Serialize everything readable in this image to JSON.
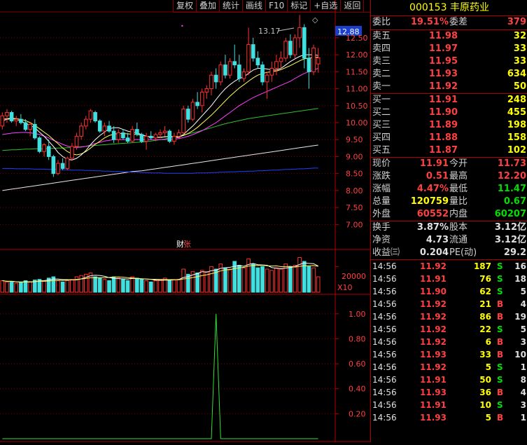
{
  "toolbar": {
    "items": [
      "复权",
      "叠加",
      "统计",
      "画线",
      "F10",
      "标记",
      "+自选",
      "返回"
    ]
  },
  "stock": {
    "code": "000153",
    "name": "丰原药业"
  },
  "ratio": {
    "label": "委比",
    "value": "19.51%",
    "diff_label": "委差",
    "diff": "379"
  },
  "sells": [
    {
      "label": "卖五",
      "price": "11.98",
      "vol": "32"
    },
    {
      "label": "卖四",
      "price": "11.97",
      "vol": "33"
    },
    {
      "label": "卖三",
      "price": "11.95",
      "vol": "33"
    },
    {
      "label": "卖二",
      "price": "11.93",
      "vol": "634"
    },
    {
      "label": "卖一",
      "price": "11.92",
      "vol": "50"
    }
  ],
  "buys": [
    {
      "label": "买一",
      "price": "11.91",
      "vol": "248"
    },
    {
      "label": "买二",
      "price": "11.90",
      "vol": "455"
    },
    {
      "label": "买三",
      "price": "11.89",
      "vol": "198"
    },
    {
      "label": "买四",
      "price": "11.88",
      "vol": "158"
    },
    {
      "label": "买五",
      "price": "11.87",
      "vol": "102"
    }
  ],
  "quote": [
    {
      "l1": "现价",
      "v1": "11.91",
      "l2": "今开",
      "v2": "11.73"
    },
    {
      "l1": "涨跌",
      "v1": "0.51",
      "l2": "最高",
      "v2": "12.20"
    },
    {
      "l1": "涨幅",
      "v1": "4.47%",
      "l2": "最低",
      "v2": "11.47"
    },
    {
      "l1": "总量",
      "v1": "120759",
      "l2": "量比",
      "v2": "0.67"
    },
    {
      "l1": "外盘",
      "v1": "60552",
      "l2": "内盘",
      "v2": "60207"
    }
  ],
  "fund": [
    {
      "l1": "换手",
      "v1": "3.87%",
      "l2": "股本",
      "v2": "3.12亿"
    },
    {
      "l1": "净资",
      "v1": "4.73",
      "l2": "流通",
      "v2": "3.12亿"
    },
    {
      "l1": "收益㈢",
      "v1": "0.204",
      "l2": "PE(动)",
      "v2": "29.2"
    }
  ],
  "ticks": [
    {
      "time": "14:56",
      "price": "11.92",
      "vol": "187",
      "bs": "S",
      "n": "16"
    },
    {
      "time": "14:56",
      "price": "11.91",
      "vol": "76",
      "bs": "S",
      "n": "18"
    },
    {
      "time": "14:56",
      "price": "11.90",
      "vol": "62",
      "bs": "S",
      "n": "5"
    },
    {
      "time": "14:56",
      "price": "11.92",
      "vol": "21",
      "bs": "B",
      "n": "4"
    },
    {
      "time": "14:56",
      "price": "11.92",
      "vol": "86",
      "bs": "B",
      "n": "19"
    },
    {
      "time": "14:56",
      "price": "11.92",
      "vol": "22",
      "bs": "S",
      "n": "5"
    },
    {
      "time": "14:56",
      "price": "11.92",
      "vol": "6",
      "bs": "B",
      "n": "3"
    },
    {
      "time": "14:56",
      "price": "11.93",
      "vol": "33",
      "bs": "B",
      "n": "10"
    },
    {
      "time": "14:56",
      "price": "11.92",
      "vol": "5",
      "bs": "S",
      "n": "1"
    },
    {
      "time": "14:56",
      "price": "11.91",
      "vol": "50",
      "bs": "S",
      "n": "8"
    },
    {
      "time": "14:56",
      "price": "11.93",
      "vol": "36",
      "bs": "B",
      "n": "4"
    },
    {
      "time": "14:56",
      "price": "11.91",
      "vol": "10",
      "bs": "S",
      "n": "3"
    },
    {
      "time": "14:56",
      "price": "11.93",
      "vol": "5",
      "bs": "B",
      "n": "1"
    }
  ],
  "chart": {
    "current_price": "12.88",
    "high_marker": "13.17",
    "event_marker": "财",
    "event_label": "张",
    "vol_axis": "20000",
    "vol_unit": "X10",
    "price_ticks": [
      "12.50",
      "12.00",
      "11.50",
      "11.00",
      "10.50",
      "10.00",
      "9.50",
      "9.00",
      "8.50",
      "8.00",
      "7.50",
      "7.00"
    ],
    "ind_ticks": [
      "1.00",
      "0.80",
      "0.60",
      "0.40",
      "0.20"
    ]
  },
  "chart_data": {
    "type": "candlestick",
    "price_range": [
      6.8,
      13.2
    ],
    "candles": [
      [
        9.9,
        10.3,
        9.8,
        10.2
      ],
      [
        10.2,
        10.4,
        10.0,
        10.3
      ],
      [
        10.3,
        10.35,
        10.0,
        10.05
      ],
      [
        10.05,
        10.2,
        9.9,
        10.1
      ],
      [
        10.1,
        10.25,
        9.95,
        10.0
      ],
      [
        10.0,
        10.1,
        9.75,
        9.8
      ],
      [
        9.8,
        10.0,
        9.6,
        9.95
      ],
      [
        9.95,
        10.1,
        9.5,
        9.55
      ],
      [
        9.55,
        9.6,
        9.1,
        9.15
      ],
      [
        9.15,
        9.4,
        9.0,
        9.35
      ],
      [
        9.3,
        9.5,
        8.9,
        9.0
      ],
      [
        9.0,
        9.05,
        8.4,
        8.5
      ],
      [
        8.5,
        8.9,
        8.45,
        8.8
      ],
      [
        8.8,
        8.95,
        8.6,
        8.65
      ],
      [
        8.65,
        9.0,
        8.6,
        8.95
      ],
      [
        8.95,
        9.4,
        8.9,
        9.3
      ],
      [
        9.3,
        9.7,
        9.2,
        9.6
      ],
      [
        9.6,
        10.0,
        9.5,
        9.9
      ],
      [
        9.9,
        10.2,
        9.8,
        10.1
      ],
      [
        10.1,
        10.4,
        10.0,
        10.35
      ],
      [
        10.3,
        10.35,
        10.0,
        10.05
      ],
      [
        10.05,
        10.1,
        9.7,
        9.75
      ],
      [
        9.75,
        10.0,
        9.6,
        9.9
      ],
      [
        9.9,
        10.05,
        9.7,
        9.75
      ],
      [
        9.75,
        9.9,
        9.4,
        9.5
      ],
      [
        9.5,
        9.8,
        9.4,
        9.7
      ],
      [
        9.7,
        9.8,
        9.5,
        9.55
      ],
      [
        9.55,
        9.7,
        9.4,
        9.45
      ],
      [
        9.45,
        9.9,
        9.4,
        9.8
      ],
      [
        9.8,
        10.0,
        9.6,
        9.65
      ],
      [
        9.65,
        9.7,
        9.4,
        9.45
      ],
      [
        9.45,
        9.7,
        9.2,
        9.6
      ],
      [
        9.6,
        9.75,
        9.5,
        9.55
      ],
      [
        9.55,
        9.7,
        9.45,
        9.65
      ],
      [
        9.65,
        9.8,
        9.55,
        9.7
      ],
      [
        9.7,
        9.9,
        9.6,
        9.75
      ],
      [
        9.75,
        9.8,
        9.4,
        9.45
      ],
      [
        9.45,
        9.7,
        9.35,
        9.6
      ],
      [
        9.6,
        9.8,
        9.55,
        9.7
      ],
      [
        9.7,
        10.5,
        9.65,
        10.4
      ],
      [
        10.4,
        10.5,
        10.0,
        10.1
      ],
      [
        10.1,
        10.7,
        10.05,
        10.6
      ],
      [
        10.6,
        10.9,
        10.4,
        10.5
      ],
      [
        10.5,
        11.0,
        10.3,
        10.9
      ],
      [
        10.9,
        11.1,
        10.7,
        11.0
      ],
      [
        11.0,
        11.5,
        10.8,
        11.4
      ],
      [
        11.4,
        11.6,
        11.0,
        11.2
      ],
      [
        11.2,
        11.8,
        11.1,
        11.7
      ],
      [
        11.7,
        12.0,
        11.3,
        11.4
      ],
      [
        11.4,
        11.9,
        11.3,
        11.8
      ],
      [
        11.8,
        12.3,
        11.6,
        11.7
      ],
      [
        11.7,
        12.0,
        11.2,
        11.3
      ],
      [
        11.3,
        11.6,
        11.2,
        11.5
      ],
      [
        11.5,
        12.8,
        11.4,
        12.3
      ],
      [
        12.3,
        12.5,
        11.8,
        11.9
      ],
      [
        11.9,
        12.1,
        11.6,
        11.7
      ],
      [
        11.7,
        11.8,
        11.1,
        11.2
      ],
      [
        11.2,
        11.5,
        10.7,
        11.4
      ],
      [
        11.4,
        11.8,
        11.2,
        11.6
      ],
      [
        11.6,
        12.0,
        11.4,
        11.8
      ],
      [
        11.8,
        12.1,
        11.6,
        11.9
      ],
      [
        11.9,
        12.5,
        11.8,
        12.4
      ],
      [
        12.4,
        12.6,
        11.9,
        12.0
      ],
      [
        12.0,
        12.6,
        11.9,
        12.5
      ],
      [
        12.5,
        13.17,
        12.2,
        12.8
      ],
      [
        12.8,
        12.9,
        11.6,
        11.9
      ],
      [
        11.9,
        12.2,
        11.0,
        11.5
      ],
      [
        11.5,
        12.3,
        11.4,
        12.2
      ],
      [
        11.73,
        12.2,
        11.47,
        11.91
      ]
    ],
    "ma_white": [
      10.05,
      10.1,
      10.12,
      10.1,
      10.05,
      9.98,
      9.92,
      9.85,
      9.72,
      9.6,
      9.45,
      9.3,
      9.12,
      9.0,
      8.92,
      8.9,
      8.95,
      9.05,
      9.18,
      9.35,
      9.5,
      9.62,
      9.72,
      9.82,
      9.85,
      9.85,
      9.8,
      9.75,
      9.72,
      9.7,
      9.65,
      9.6,
      9.58,
      9.57,
      9.56,
      9.58,
      9.6,
      9.58,
      9.56,
      9.65,
      9.78,
      9.9,
      10.05,
      10.2,
      10.35,
      10.5,
      10.68,
      10.85,
      11.0,
      11.12,
      11.22,
      11.3,
      11.35,
      11.45,
      11.55,
      11.6,
      11.6,
      11.58,
      11.55,
      11.55,
      11.6,
      11.7,
      11.8,
      11.88,
      11.95,
      12.0,
      12.0,
      12.0,
      11.98
    ],
    "ma_yellow": [
      10.1,
      10.12,
      10.13,
      10.12,
      10.1,
      10.06,
      10.0,
      9.92,
      9.82,
      9.72,
      9.62,
      9.5,
      9.38,
      9.25,
      9.15,
      9.08,
      9.05,
      9.08,
      9.15,
      9.25,
      9.36,
      9.45,
      9.55,
      9.62,
      9.66,
      9.68,
      9.68,
      9.67,
      9.66,
      9.65,
      9.63,
      9.6,
      9.58,
      9.57,
      9.57,
      9.58,
      9.59,
      9.58,
      9.58,
      9.62,
      9.68,
      9.76,
      9.86,
      9.98,
      10.1,
      10.22,
      10.36,
      10.5,
      10.64,
      10.78,
      10.9,
      11.02,
      11.12,
      11.22,
      11.32,
      11.4,
      11.45,
      11.48,
      11.5,
      11.52,
      11.56,
      11.62,
      11.68,
      11.75,
      11.82,
      11.88,
      11.9,
      11.92,
      11.93
    ],
    "ma_magenta": [
      9.65,
      9.67,
      9.69,
      9.7,
      9.71,
      9.71,
      9.7,
      9.68,
      9.65,
      9.6,
      9.55,
      9.48,
      9.42,
      9.36,
      9.31,
      9.28,
      9.27,
      9.28,
      9.3,
      9.34,
      9.38,
      9.42,
      9.46,
      9.48,
      9.5,
      9.5,
      9.5,
      9.5,
      9.5,
      9.5,
      9.5,
      9.5,
      9.5,
      9.5,
      9.5,
      9.5,
      9.51,
      9.52,
      9.53,
      9.56,
      9.6,
      9.65,
      9.7,
      9.76,
      9.84,
      9.92,
      10.0,
      10.1,
      10.2,
      10.3,
      10.4,
      10.5,
      10.58,
      10.66,
      10.74,
      10.8,
      10.86,
      10.92,
      10.98,
      11.04,
      11.1,
      11.16,
      11.22,
      11.3,
      11.38,
      11.45,
      11.5,
      11.55,
      11.6
    ],
    "ma_green": [
      9.18,
      9.19,
      9.2,
      9.2,
      9.21,
      9.22,
      9.22,
      9.23,
      9.23,
      9.23,
      9.24,
      9.24,
      9.25,
      9.25,
      9.26,
      9.27,
      9.28,
      9.29,
      9.3,
      9.32,
      9.33,
      9.34,
      9.35,
      9.36,
      9.37,
      9.38,
      9.39,
      9.4,
      9.41,
      9.42,
      9.43,
      9.44,
      9.46,
      9.48,
      9.5,
      9.52,
      9.55,
      9.58,
      9.61,
      9.64,
      9.67,
      9.7,
      9.73,
      9.77,
      9.81,
      9.85,
      9.89,
      9.93,
      9.97,
      10.0,
      10.03,
      10.06,
      10.09,
      10.12,
      10.14,
      10.16,
      10.18,
      10.2,
      10.22,
      10.24,
      10.26,
      10.28,
      10.3,
      10.32,
      10.34,
      10.36,
      10.38,
      10.4,
      10.42
    ],
    "ma_gray": [
      8.0,
      8.02,
      8.04,
      8.06,
      8.08,
      8.1,
      8.12,
      8.14,
      8.16,
      8.18,
      8.2,
      8.22,
      8.24,
      8.26,
      8.28,
      8.3,
      8.32,
      8.34,
      8.36,
      8.38,
      8.4,
      8.42,
      8.44,
      8.46,
      8.48,
      8.5,
      8.52,
      8.54,
      8.56,
      8.57,
      8.58,
      8.6,
      8.62,
      8.64,
      8.66,
      8.68,
      8.7,
      8.72,
      8.74,
      8.76,
      8.78,
      8.8,
      8.82,
      8.84,
      8.86,
      8.88,
      8.9,
      8.92,
      8.94,
      8.96,
      8.98,
      9.0,
      9.02,
      9.04,
      9.06,
      9.08,
      9.1,
      9.12,
      9.14,
      9.16,
      9.18,
      9.2,
      9.22,
      9.24,
      9.26,
      9.28,
      9.3,
      9.32,
      9.34
    ],
    "ma_blue": [
      8.65,
      8.65,
      8.65,
      8.64,
      8.64,
      8.64,
      8.64,
      8.63,
      8.63,
      8.63,
      8.62,
      8.62,
      8.62,
      8.61,
      8.61,
      8.6,
      8.6,
      8.6,
      8.59,
      8.59,
      8.58,
      8.58,
      8.57,
      8.57,
      8.56,
      8.56,
      8.55,
      8.55,
      8.54,
      8.54,
      8.53,
      8.53,
      8.52,
      8.52,
      8.52,
      8.51,
      8.51,
      8.51,
      8.51,
      8.51,
      8.51,
      8.51,
      8.52,
      8.52,
      8.52,
      8.53,
      8.53,
      8.54,
      8.54,
      8.55,
      8.55,
      8.56,
      8.56,
      8.57,
      8.57,
      8.58,
      8.58,
      8.59,
      8.6,
      8.6,
      8.61,
      8.62,
      8.62,
      8.63,
      8.64,
      8.64,
      8.65,
      8.66,
      8.66
    ],
    "volume_max": 30000,
    "volumes": [
      9000,
      8000,
      8500,
      7000,
      7500,
      9000,
      8000,
      9500,
      10000,
      9000,
      11000,
      12000,
      9000,
      8000,
      9000,
      10000,
      12000,
      13000,
      14000,
      15000,
      12000,
      11000,
      10000,
      9000,
      12000,
      11000,
      10000,
      9000,
      12000,
      11000,
      10000,
      9000,
      8000,
      9000,
      10000,
      11000,
      9000,
      9500,
      10000,
      18000,
      14000,
      16000,
      15000,
      17000,
      16000,
      20000,
      18000,
      22000,
      19000,
      18000,
      24000,
      21000,
      19000,
      26000,
      22000,
      19000,
      20000,
      18000,
      17000,
      19000,
      18000,
      22000,
      20000,
      21000,
      27000,
      24000,
      20000,
      19000,
      12000
    ],
    "indicator_range": [
      0,
      1.1
    ],
    "indicator": [
      0,
      0,
      0,
      0,
      0,
      0,
      0,
      0,
      0,
      0,
      0,
      0,
      0,
      0,
      0,
      0,
      0,
      0,
      0,
      0,
      0,
      0,
      0,
      0,
      0,
      0,
      0,
      0,
      0,
      0,
      0,
      0,
      0,
      0,
      0,
      0,
      0,
      0,
      0,
      0,
      0,
      0,
      0,
      0,
      0,
      0,
      1.0,
      0,
      0,
      0,
      0,
      0,
      0,
      0,
      0,
      0,
      0,
      0,
      0,
      0,
      0,
      0,
      0,
      0,
      0,
      0,
      0,
      0,
      0
    ]
  }
}
